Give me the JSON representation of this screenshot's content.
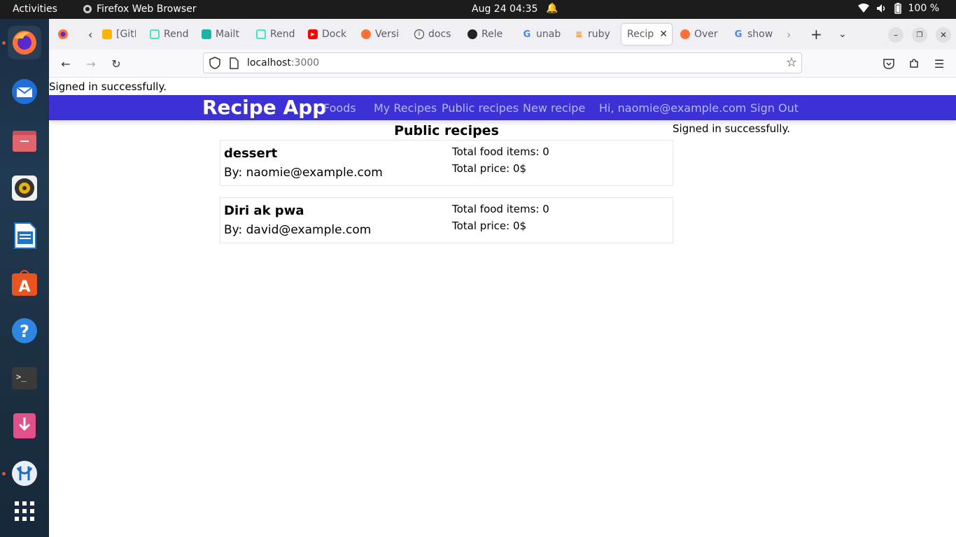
{
  "topbar": {
    "activities": "Activities",
    "app_name": "Firefox Web Browser",
    "clock": "Aug 24  04:35",
    "battery": "100 %"
  },
  "dock": {
    "items": [
      "firefox-icon",
      "thunderbird-icon",
      "files-icon",
      "rhythmbox-icon",
      "writer-icon",
      "app-center-icon",
      "help-icon",
      "terminal-icon",
      "deb-installer-icon",
      "vscode-icon",
      "show-apps-icon"
    ]
  },
  "browser": {
    "tabs": [
      {
        "label": "[GitH",
        "icon": "github"
      },
      {
        "label": "Rend",
        "icon": "render"
      },
      {
        "label": "Mailt",
        "icon": "mail"
      },
      {
        "label": "Rend",
        "icon": "render"
      },
      {
        "label": "Dock",
        "icon": "youtube"
      },
      {
        "label": "Versi",
        "icon": "firefox"
      },
      {
        "label": "docs",
        "icon": "info"
      },
      {
        "label": "Rele",
        "icon": "github"
      },
      {
        "label": "unab",
        "icon": "google"
      },
      {
        "label": "ruby",
        "icon": "stackoverflow"
      },
      {
        "label": "Recip",
        "icon": "none",
        "active": true
      },
      {
        "label": "Over",
        "icon": "firefox"
      },
      {
        "label": "show",
        "icon": "google"
      }
    ],
    "url_host": "localhost",
    "url_port": ":3000"
  },
  "page": {
    "flash_top": "Signed in successfully.",
    "nav": {
      "brand": "Recipe App",
      "foods": "Foods",
      "my_recipes": "My Recipes",
      "public_recipes": "Public recipes",
      "new_recipe": "New recipe",
      "greeting": "Hi, naomie@example.com",
      "sign_out": "Sign Out"
    },
    "flash_side": "Signed in successfully.",
    "title": "Public recipes",
    "recipes": [
      {
        "name": "dessert",
        "author": "By: naomie@example.com",
        "items": "Total food items: 0",
        "price": "Total price: 0$"
      },
      {
        "name": "Diri ak pwa",
        "author": "By: david@example.com",
        "items": "Total food items: 0",
        "price": "Total price: 0$"
      }
    ]
  },
  "colors": {
    "nav_bg": "#3d31d6",
    "nav_link": "#b7b4f0"
  }
}
